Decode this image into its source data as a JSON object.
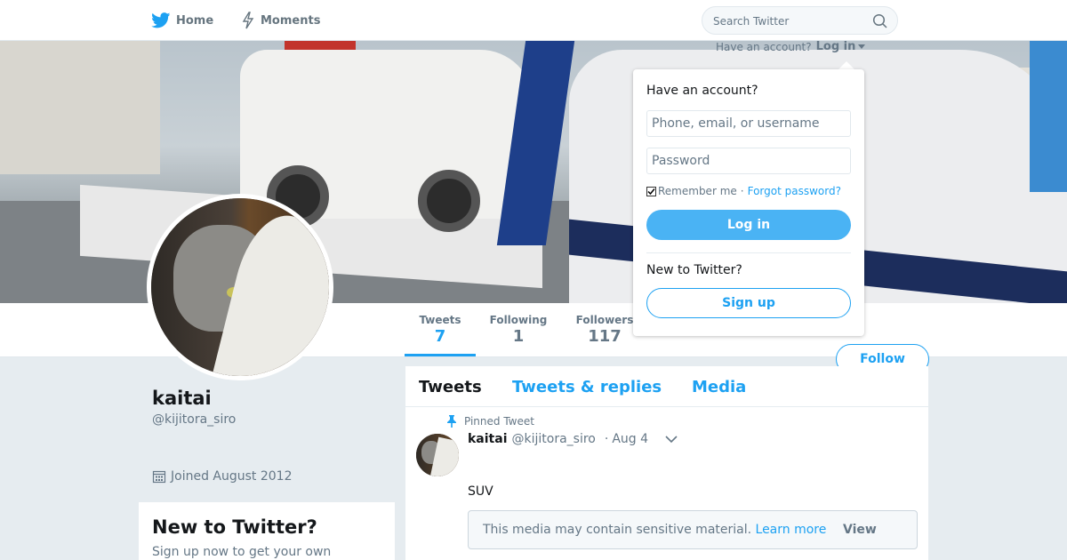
{
  "nav": {
    "home_label": "Home",
    "moments_label": "Moments",
    "search_placeholder": "Search Twitter"
  },
  "login_header": {
    "prompt": "Have an account?",
    "login_label": "Log in"
  },
  "login_dropdown": {
    "title": "Have an account?",
    "username_placeholder": "Phone, email, or username",
    "password_placeholder": "Password",
    "remember_label": "Remember me",
    "separator": "·",
    "forgot_label": "Forgot password?",
    "login_button": "Log in",
    "new_title": "New to Twitter?",
    "signup_button": "Sign up"
  },
  "profile": {
    "name": "kaitai",
    "handle": "@kijitora_siro",
    "joined": "Joined August 2012",
    "follow_button": "Follow",
    "stats": [
      {
        "label": "Tweets",
        "value": "7"
      },
      {
        "label": "Following",
        "value": "1"
      },
      {
        "label": "Followers",
        "value": "117"
      }
    ]
  },
  "new_card": {
    "title": "New to Twitter?",
    "subtitle": "Sign up now to get your own"
  },
  "timeline": {
    "tabs": [
      "Tweets",
      "Tweets & replies",
      "Media"
    ],
    "pinned_label": "Pinned Tweet",
    "tweet": {
      "name": "kaitai",
      "handle": "@kijitora_siro",
      "dot": "·",
      "date": "Aug 4",
      "text": "SUV",
      "sensitive_text": "This media may contain sensitive material.",
      "learn_more": "Learn more",
      "view_label": "View"
    }
  },
  "colors": {
    "accent": "#1da1f2",
    "login_button_bg": "#4ab3f4",
    "muted_text": "#657786",
    "page_bg": "#e6ecf0"
  },
  "icons": [
    "twitter-bird-icon",
    "lightning-icon",
    "search-icon",
    "caret-down-icon",
    "pin-icon",
    "calendar-icon",
    "chevron-down-icon",
    "checkbox-icon"
  ]
}
